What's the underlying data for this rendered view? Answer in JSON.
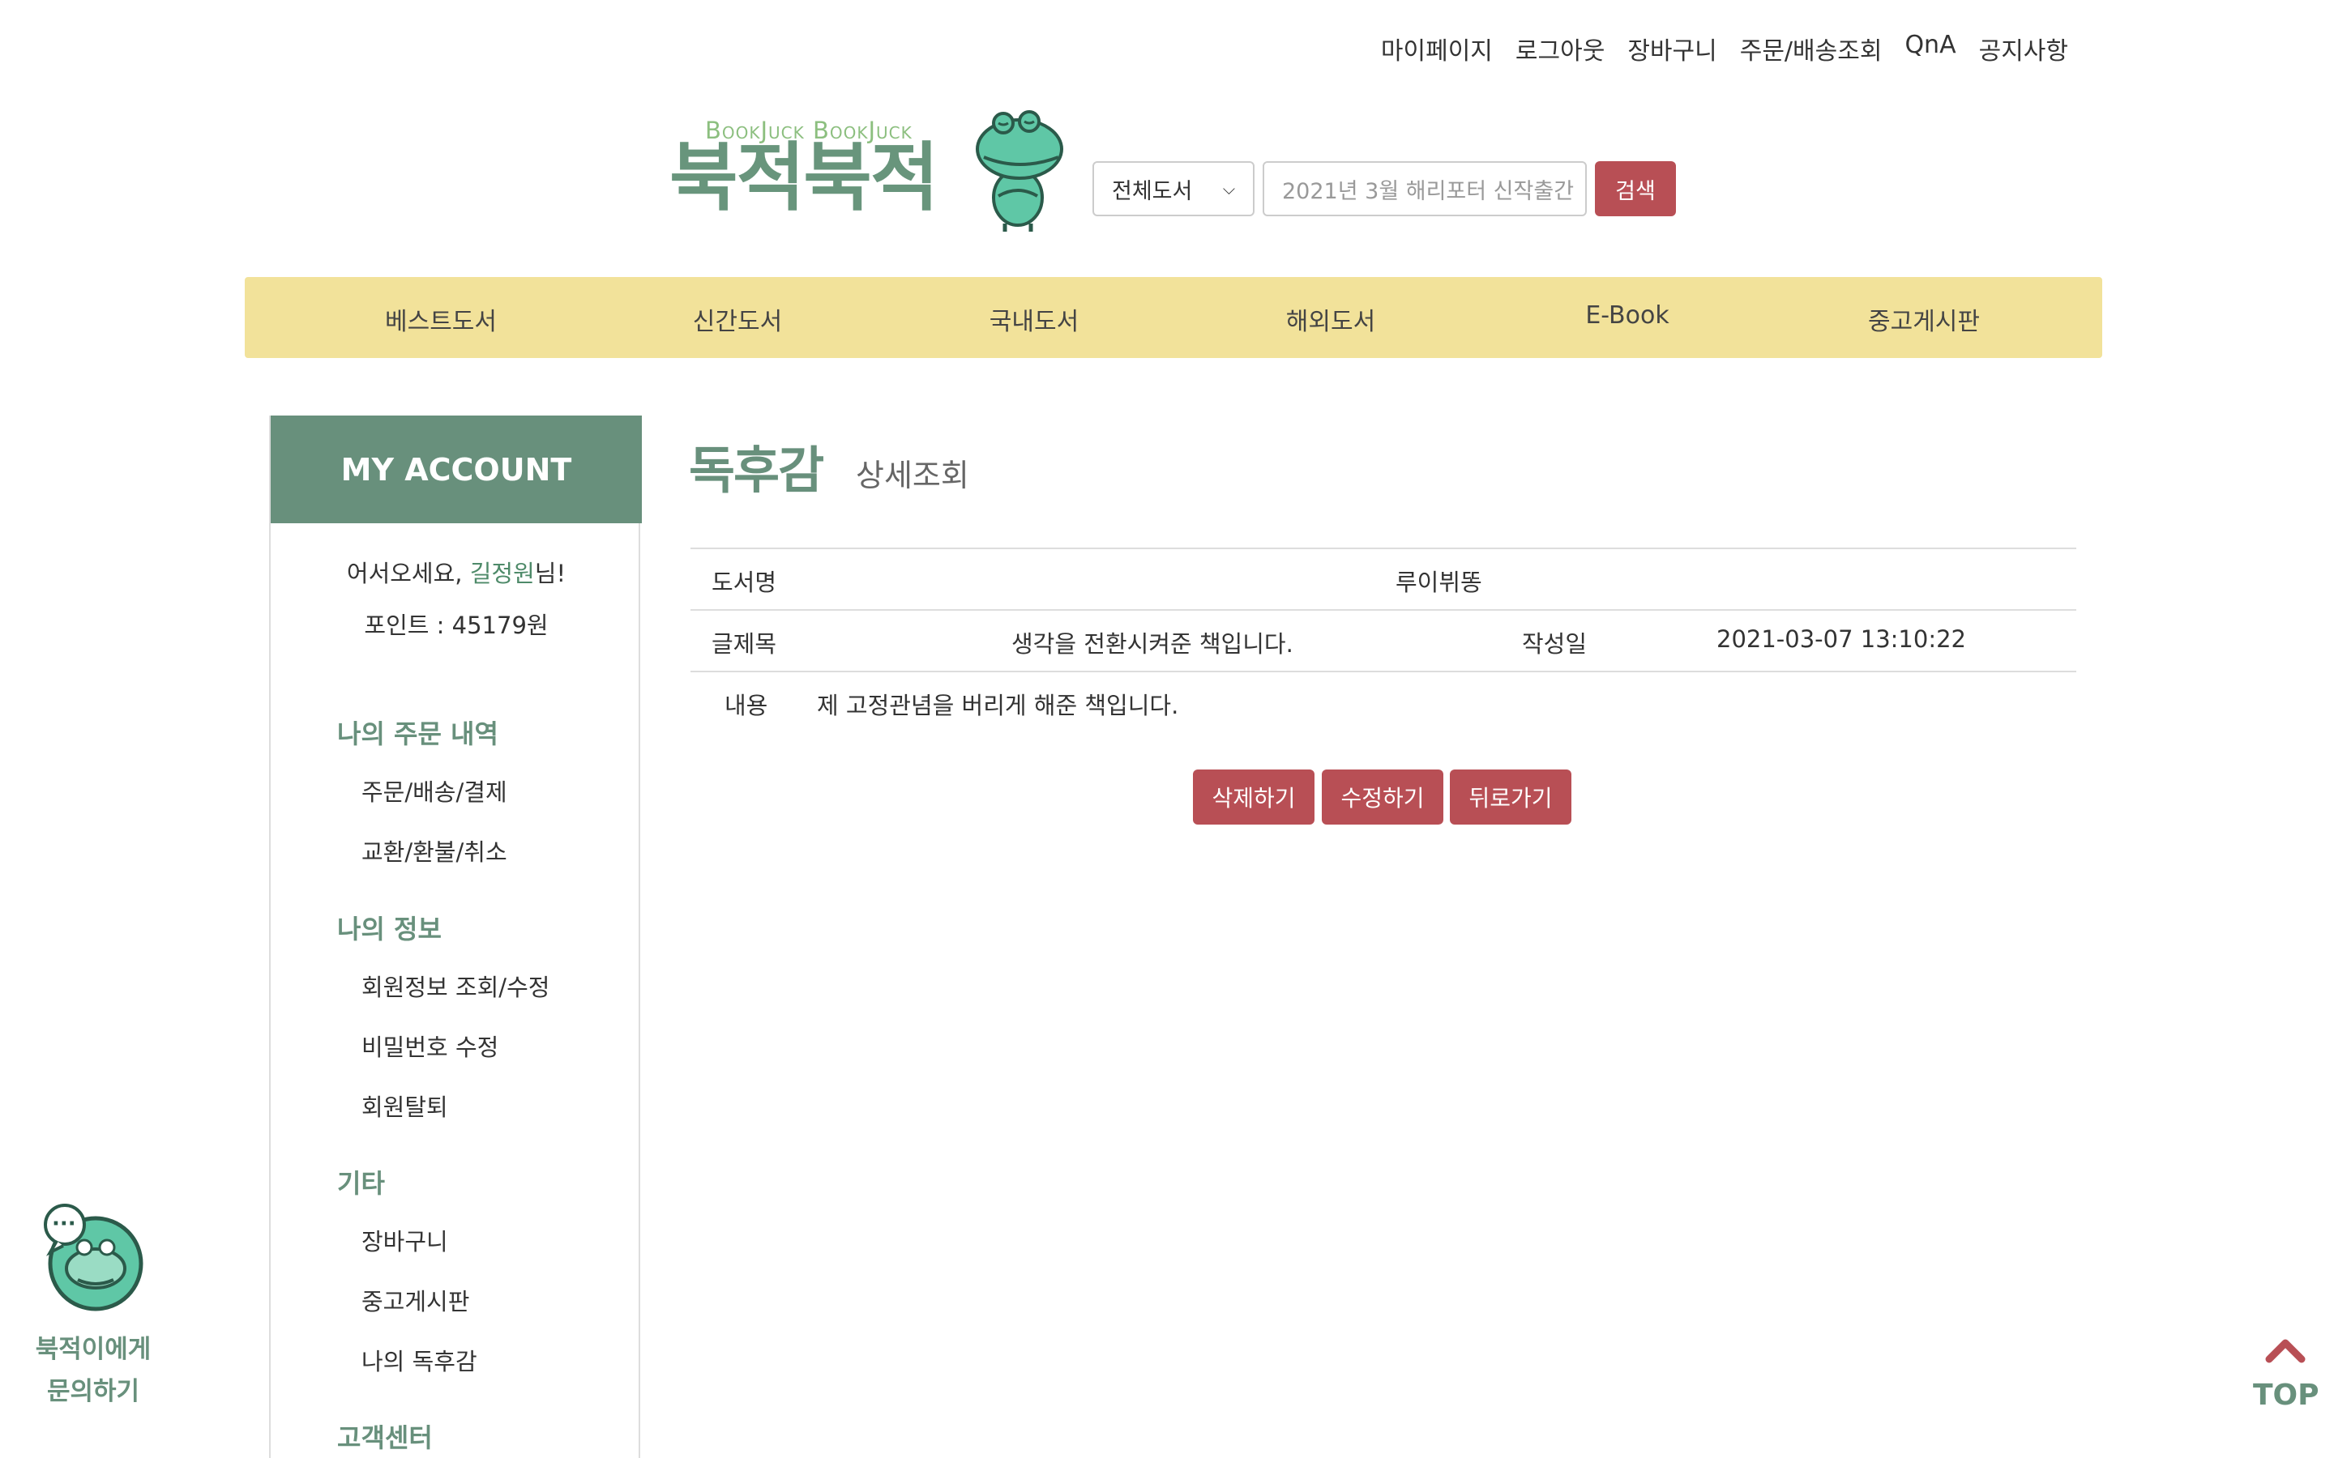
{
  "top_links": [
    "마이페이지",
    "로그아웃",
    "장바구니",
    "주문/배송조회",
    "QnA",
    "공지사항"
  ],
  "logo": {
    "eng": "BookJuck BookJuck",
    "kor": "북적북적"
  },
  "search": {
    "category": "전체도서",
    "placeholder": "2021년 3월 해리포터 신작출간",
    "button": "검색"
  },
  "nav": [
    "베스트도서",
    "신간도서",
    "국내도서",
    "해외도서",
    "E-Book",
    "중고게시판"
  ],
  "sidebar": {
    "header": "MY ACCOUNT",
    "welcome_prefix": "어서오세요, ",
    "user_name": "길정원",
    "welcome_suffix": "님!",
    "points": "포인트 : 45179원",
    "sections": [
      {
        "title": "나의 주문 내역",
        "items": [
          "주문/배송/결제",
          "교환/환불/취소"
        ]
      },
      {
        "title": "나의 정보",
        "items": [
          "회원정보 조회/수정",
          "비밀번호 수정",
          "회원탈퇴"
        ]
      },
      {
        "title": "기타",
        "items": [
          "장바구니",
          "중고게시판",
          "나의 독후감"
        ]
      },
      {
        "title": "고객센터",
        "items": []
      }
    ]
  },
  "page": {
    "title": "독후감",
    "subtitle": "상세조회"
  },
  "review": {
    "book_label": "도서명",
    "book_value": "루이뷔똥",
    "title_label": "글제목",
    "title_value": "생각을 전환시켜준 책입니다.",
    "date_label": "작성일",
    "date_value": "2021-03-07 13:10:22",
    "content_label": "내용",
    "content_value": "제 고정관념을 버리게 해준 책입니다."
  },
  "actions": {
    "delete": "삭제하기",
    "edit": "수정하기",
    "back": "뒤로가기"
  },
  "chat": {
    "label_line1": "북적이에게",
    "label_line2": "문의하기",
    "bubble": "···"
  },
  "top_button": "TOP",
  "colors": {
    "brand_green": "#68907c",
    "nav_yellow": "#f2e29a",
    "action_red": "#b84f55"
  }
}
